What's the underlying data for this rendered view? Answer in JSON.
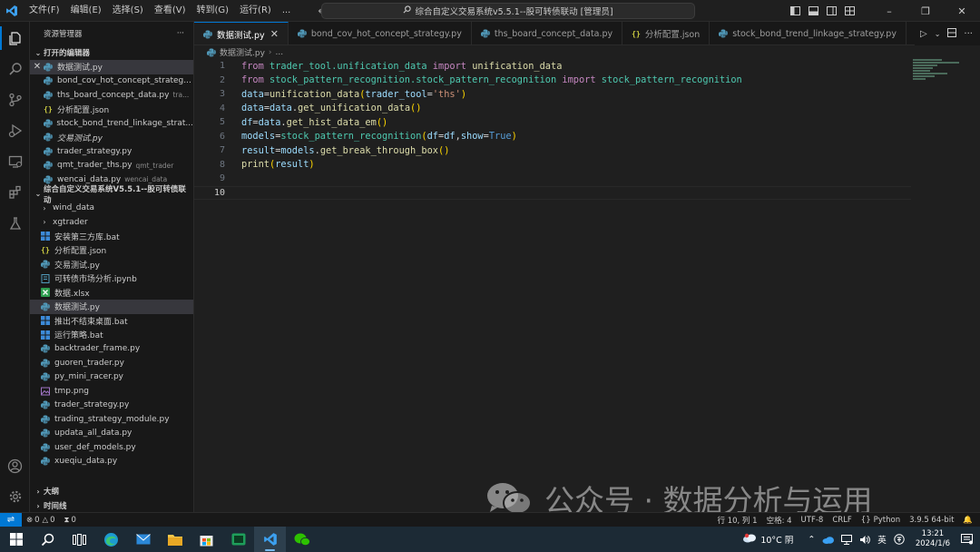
{
  "titlebar": {
    "menus": [
      "文件(F)",
      "编辑(E)",
      "选择(S)",
      "查看(V)",
      "转到(G)",
      "运行(R)",
      "..."
    ],
    "search_text": "综合自定义交易系统v5.5.1--股可转债联动 [管理员]"
  },
  "sidebar": {
    "title": "资源管理器",
    "more": "···",
    "open_editors_label": "打开的编辑器",
    "open_editors": [
      {
        "name": "数据测试.py",
        "type": "py",
        "selected": true,
        "close": true
      },
      {
        "name": "bond_cov_hot_concept_strateg...",
        "type": "py"
      },
      {
        "name": "ths_board_concept_data.py",
        "type": "py",
        "desc": "tra..."
      },
      {
        "name": "分析配置.json",
        "type": "json"
      },
      {
        "name": "stock_bond_trend_linkage_strat...",
        "type": "py"
      },
      {
        "name": "交易测试.py",
        "type": "py",
        "italic": true
      },
      {
        "name": "trader_strategy.py",
        "type": "py"
      },
      {
        "name": "qmt_trader_ths.py",
        "type": "py",
        "desc": "qmt_trader"
      },
      {
        "name": "wencai_data.py",
        "type": "py",
        "desc": "wencai_data"
      }
    ],
    "workspace_label": "综合自定义交易系统V5.5.1--股可转债联动",
    "files": [
      {
        "name": "wind_data",
        "type": "folder"
      },
      {
        "name": "xgtrader",
        "type": "folder"
      },
      {
        "name": "安装第三方库.bat",
        "type": "bat"
      },
      {
        "name": "分析配置.json",
        "type": "json"
      },
      {
        "name": "交易测试.py",
        "type": "py"
      },
      {
        "name": "可转债市场分析.ipynb",
        "type": "ipynb"
      },
      {
        "name": "数据.xlsx",
        "type": "xlsx"
      },
      {
        "name": "数据测试.py",
        "type": "py",
        "selected": true
      },
      {
        "name": "推出不结束桌面.bat",
        "type": "bat"
      },
      {
        "name": "运行策略.bat",
        "type": "bat"
      },
      {
        "name": "backtrader_frame.py",
        "type": "py"
      },
      {
        "name": "guoren_trader.py",
        "type": "py"
      },
      {
        "name": "py_mini_racer.py",
        "type": "py"
      },
      {
        "name": "tmp.png",
        "type": "png"
      },
      {
        "name": "trader_strategy.py",
        "type": "py"
      },
      {
        "name": "trading_strategy_module.py",
        "type": "py"
      },
      {
        "name": "updata_all_data.py",
        "type": "py"
      },
      {
        "name": "user_def_models.py",
        "type": "py"
      },
      {
        "name": "xueqiu_data.py",
        "type": "py"
      }
    ],
    "outline_label": "大纲",
    "timeline_label": "时间线"
  },
  "tabs": [
    {
      "name": "数据测试.py",
      "type": "py",
      "active": true
    },
    {
      "name": "bond_cov_hot_concept_strategy.py",
      "type": "py"
    },
    {
      "name": "ths_board_concept_data.py",
      "type": "py"
    },
    {
      "name": "分析配置.json",
      "type": "json"
    },
    {
      "name": "stock_bond_trend_linkage_strategy.py",
      "type": "py"
    },
    {
      "name": "交易测试.py",
      "type": "py",
      "italic": true
    }
  ],
  "breadcrumb": {
    "file": "数据测试.py",
    "rest": "..."
  },
  "editor": {
    "line_numbers": [
      "1",
      "2",
      "3",
      "4",
      "5",
      "6",
      "7",
      "8",
      "9",
      "10"
    ],
    "current_line": 10,
    "code": [
      {
        "t": "from",
        "c": "kw"
      },
      {
        "t": " trader_tool.unification_data ",
        "c": "mod"
      },
      {
        "t": "import",
        "c": "kw"
      },
      {
        "t": " unification_data",
        "c": "fn"
      },
      {
        "t": "from",
        "c": "kw"
      },
      {
        "t": " stock_pattern_recognition.stock_pattern_recognition ",
        "c": "mod"
      },
      {
        "t": "import",
        "c": "kw"
      },
      {
        "t": " stock_pattern_recognition",
        "c": "mod"
      },
      {
        "t": "data",
        "c": "var"
      },
      {
        "t": "=",
        "c": "op"
      },
      {
        "t": "unification_data",
        "c": "fn"
      },
      {
        "t": "(",
        "c": "br"
      },
      {
        "t": "trader_tool",
        "c": "var"
      },
      {
        "t": "=",
        "c": "op"
      },
      {
        "t": "'ths'",
        "c": "str"
      },
      {
        "t": ")",
        "c": "br"
      },
      {
        "t": "data",
        "c": "var"
      },
      {
        "t": "=",
        "c": "op"
      },
      {
        "t": "data",
        "c": "var"
      },
      {
        "t": ".",
        "c": "op"
      },
      {
        "t": "get_unification_data",
        "c": "fn"
      },
      {
        "t": "()",
        "c": "br"
      },
      {
        "t": "df",
        "c": "var"
      },
      {
        "t": "=",
        "c": "op"
      },
      {
        "t": "data",
        "c": "var"
      },
      {
        "t": ".",
        "c": "op"
      },
      {
        "t": "get_hist_data_em",
        "c": "fn"
      },
      {
        "t": "()",
        "c": "br"
      },
      {
        "t": "models",
        "c": "var"
      },
      {
        "t": "=",
        "c": "op"
      },
      {
        "t": "stock_pattern_recognition",
        "c": "mod"
      },
      {
        "t": "(",
        "c": "br"
      },
      {
        "t": "df",
        "c": "var"
      },
      {
        "t": "=",
        "c": "op"
      },
      {
        "t": "df",
        "c": "var"
      },
      {
        "t": ",",
        "c": "op"
      },
      {
        "t": "show",
        "c": "var"
      },
      {
        "t": "=",
        "c": "op"
      },
      {
        "t": "True",
        "c": "con"
      },
      {
        "t": ")",
        "c": "br"
      },
      {
        "t": "result",
        "c": "var"
      },
      {
        "t": "=",
        "c": "op"
      },
      {
        "t": "models",
        "c": "var"
      },
      {
        "t": ".",
        "c": "op"
      },
      {
        "t": "get_break_through_box",
        "c": "fn"
      },
      {
        "t": "()",
        "c": "br"
      },
      {
        "t": "print",
        "c": "fn"
      },
      {
        "t": "(",
        "c": "br"
      },
      {
        "t": "result",
        "c": "var"
      },
      {
        "t": ")",
        "c": "br"
      }
    ],
    "line_token_counts": [
      4,
      4,
      8,
      6,
      6,
      12,
      6,
      4,
      0,
      0
    ]
  },
  "watermark": {
    "text": "公众号 · 数据分析与运用"
  },
  "statusbar": {
    "errors": "0",
    "warnings": "0",
    "ports": "0",
    "position": "行 10, 列 1",
    "spaces": "空格: 4",
    "encoding": "UTF-8",
    "eol": "CRLF",
    "language": "Python",
    "interpreter": "3.9.5 64-bit"
  },
  "taskbar": {
    "weather": "10°C 阴",
    "ime": "英",
    "time": "13:21",
    "date": "2024/1/6"
  },
  "colors": {
    "accent": "#0078d4",
    "python_icon": "#519aba",
    "json_icon": "#cbcb41"
  }
}
